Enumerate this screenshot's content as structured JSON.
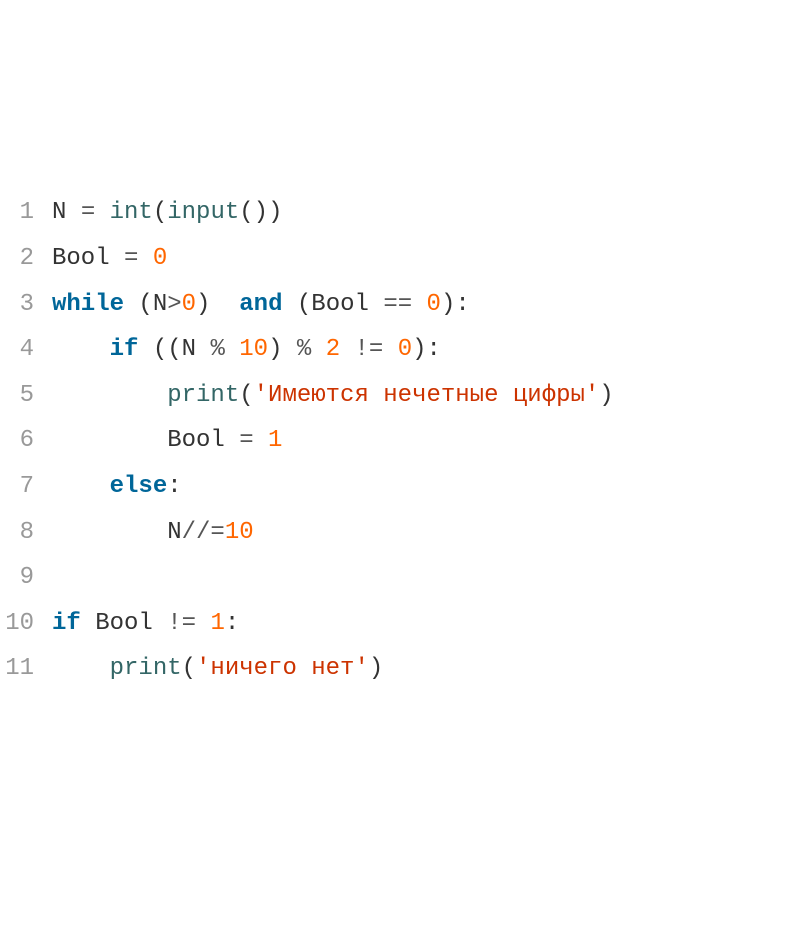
{
  "lines": [
    {
      "num": "1",
      "tokens": [
        [
          "name",
          "N"
        ],
        [
          "plain",
          " "
        ],
        [
          "op",
          "="
        ],
        [
          "plain",
          " "
        ],
        [
          "builtin",
          "int"
        ],
        [
          "punct",
          "("
        ],
        [
          "builtin",
          "input"
        ],
        [
          "punct",
          "())"
        ]
      ]
    },
    {
      "num": "2",
      "tokens": [
        [
          "name",
          "Bool"
        ],
        [
          "plain",
          " "
        ],
        [
          "op",
          "="
        ],
        [
          "plain",
          " "
        ],
        [
          "num",
          "0"
        ]
      ]
    },
    {
      "num": "3",
      "tokens": [
        [
          "kw",
          "while"
        ],
        [
          "plain",
          " "
        ],
        [
          "punct",
          "("
        ],
        [
          "name",
          "N"
        ],
        [
          "op",
          ">"
        ],
        [
          "num",
          "0"
        ],
        [
          "punct",
          ")"
        ],
        [
          "plain",
          "  "
        ],
        [
          "kw",
          "and"
        ],
        [
          "plain",
          " "
        ],
        [
          "punct",
          "("
        ],
        [
          "name",
          "Bool"
        ],
        [
          "plain",
          " "
        ],
        [
          "op",
          "=="
        ],
        [
          "plain",
          " "
        ],
        [
          "num",
          "0"
        ],
        [
          "punct",
          "):"
        ]
      ]
    },
    {
      "num": "4",
      "tokens": [
        [
          "plain",
          "    "
        ],
        [
          "kw",
          "if"
        ],
        [
          "plain",
          " "
        ],
        [
          "punct",
          "(("
        ],
        [
          "name",
          "N"
        ],
        [
          "plain",
          " "
        ],
        [
          "op",
          "%"
        ],
        [
          "plain",
          " "
        ],
        [
          "num",
          "10"
        ],
        [
          "punct",
          ")"
        ],
        [
          "plain",
          " "
        ],
        [
          "op",
          "%"
        ],
        [
          "plain",
          " "
        ],
        [
          "num",
          "2"
        ],
        [
          "plain",
          " "
        ],
        [
          "op",
          "!="
        ],
        [
          "plain",
          " "
        ],
        [
          "num",
          "0"
        ],
        [
          "punct",
          "):"
        ]
      ]
    },
    {
      "num": "5",
      "tokens": [
        [
          "plain",
          "        "
        ],
        [
          "builtin",
          "print"
        ],
        [
          "punct",
          "("
        ],
        [
          "str",
          "'Имеются нечетные цифры'"
        ],
        [
          "punct",
          ")"
        ]
      ]
    },
    {
      "num": "6",
      "tokens": [
        [
          "plain",
          "        "
        ],
        [
          "name",
          "Bool"
        ],
        [
          "plain",
          " "
        ],
        [
          "op",
          "="
        ],
        [
          "plain",
          " "
        ],
        [
          "num",
          "1"
        ]
      ]
    },
    {
      "num": "7",
      "tokens": [
        [
          "plain",
          "    "
        ],
        [
          "kw",
          "else"
        ],
        [
          "punct",
          ":"
        ]
      ]
    },
    {
      "num": "8",
      "tokens": [
        [
          "plain",
          "        "
        ],
        [
          "name",
          "N"
        ],
        [
          "op",
          "//="
        ],
        [
          "num",
          "10"
        ]
      ]
    },
    {
      "num": "9",
      "tokens": []
    },
    {
      "num": "10",
      "tokens": [
        [
          "kw",
          "if"
        ],
        [
          "plain",
          " "
        ],
        [
          "name",
          "Bool"
        ],
        [
          "plain",
          " "
        ],
        [
          "op",
          "!="
        ],
        [
          "plain",
          " "
        ],
        [
          "num",
          "1"
        ],
        [
          "punct",
          ":"
        ]
      ]
    },
    {
      "num": "11",
      "tokens": [
        [
          "plain",
          "    "
        ],
        [
          "builtin",
          "print"
        ],
        [
          "punct",
          "("
        ],
        [
          "str",
          "'ничего нет'"
        ],
        [
          "punct",
          ")"
        ]
      ]
    }
  ]
}
